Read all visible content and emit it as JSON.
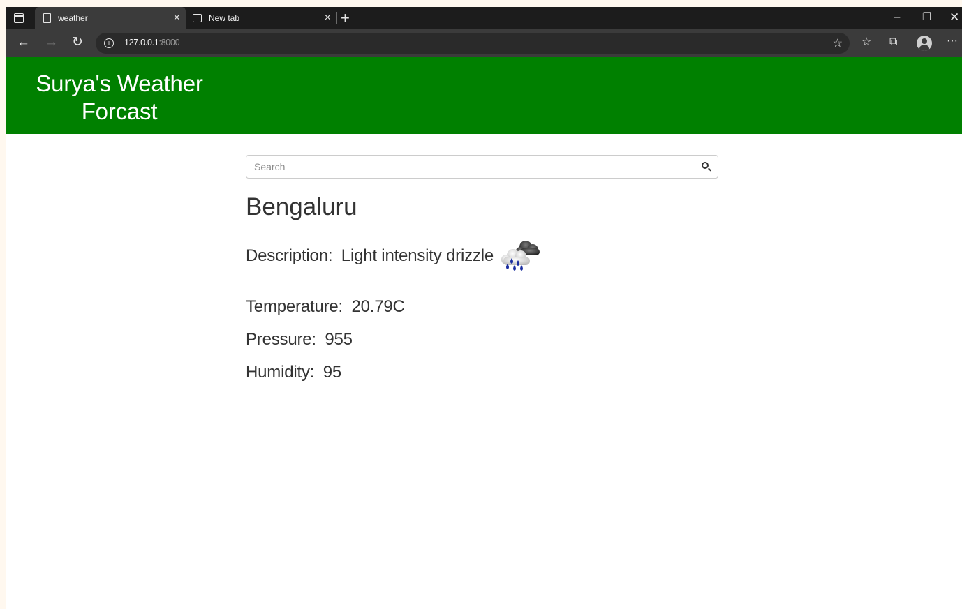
{
  "browser": {
    "tabs": [
      {
        "title": "weather",
        "active": true,
        "icon": "page-icon"
      },
      {
        "title": "New tab",
        "active": false,
        "icon": "new-tab-icon"
      }
    ],
    "close_glyph": "×",
    "new_tab_glyph": "+",
    "window": {
      "minimize": "–",
      "maximize": "❐",
      "close": "✕"
    },
    "nav": {
      "back": "←",
      "forward": "→",
      "reload": "↻"
    },
    "url": {
      "host": "127.0.0.1",
      "port": ":8000"
    },
    "info_glyph": "i",
    "icons": {
      "favorite_add": "☆",
      "favorites": "☆",
      "collections": "⧉",
      "more": "···"
    }
  },
  "page": {
    "site_title": "Surya's Weather Forcast",
    "search": {
      "placeholder": "Search",
      "value": ""
    },
    "city": "Bengaluru",
    "description": {
      "label": "Description:",
      "value": "Light intensity drizzle"
    },
    "temperature": {
      "label": "Temperature:",
      "value": "20.79C"
    },
    "pressure": {
      "label": "Pressure:",
      "value": "955"
    },
    "humidity": {
      "label": "Humidity:",
      "value": "95"
    },
    "colors": {
      "header": "#008000",
      "text": "#333333"
    }
  }
}
